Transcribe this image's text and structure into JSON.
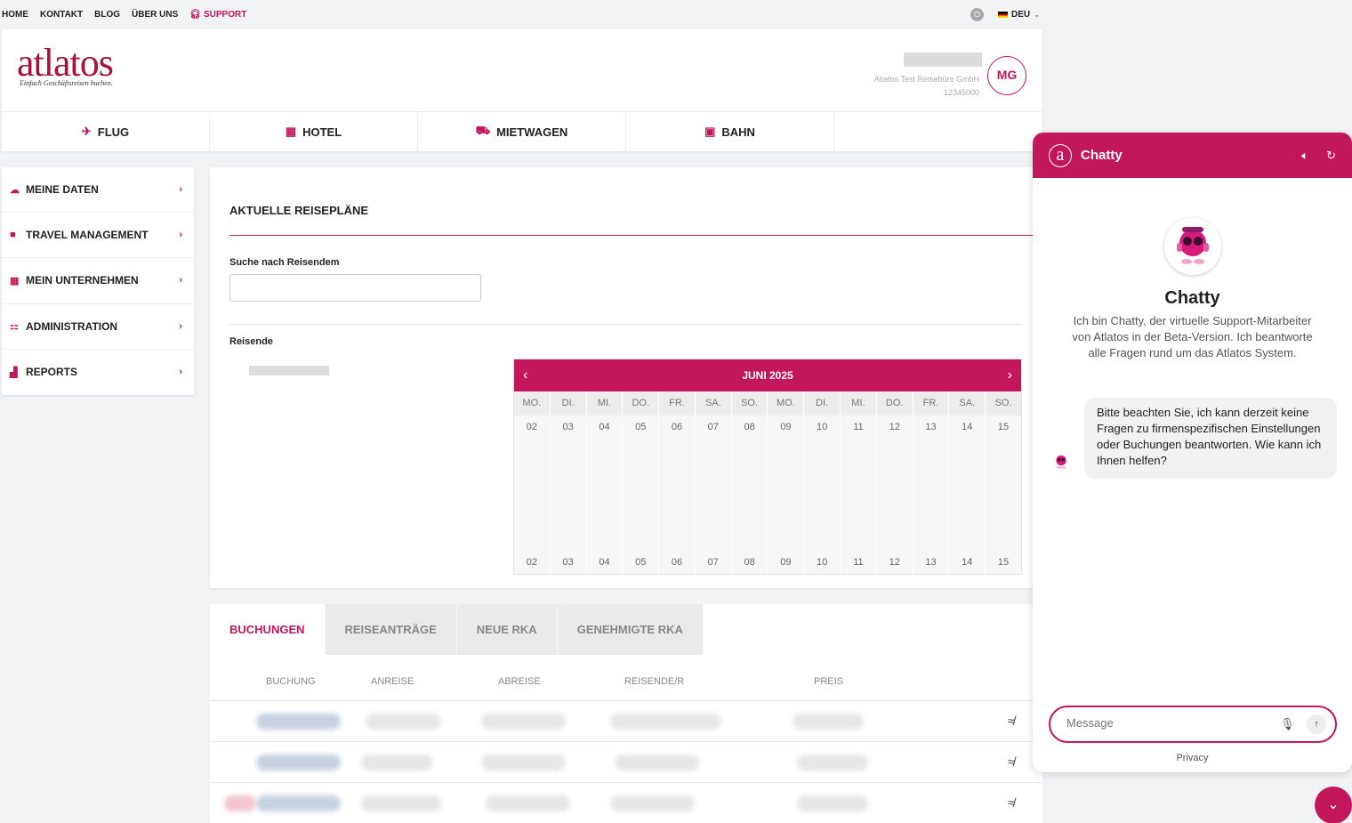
{
  "topnav": {
    "items": [
      "HOME",
      "KONTAKT",
      "BLOG",
      "ÜBER UNS"
    ],
    "support": "SUPPORT",
    "language": "DEU"
  },
  "header": {
    "logo": "atlatos",
    "tagline": "Einfach Geschäftsreisen buchen.",
    "company": "Atlatos Test Reisebüro GmbH",
    "company_id": "12345000",
    "avatar_initials": "MG"
  },
  "mainnav": [
    {
      "label": "FLUG",
      "icon": "plane-icon"
    },
    {
      "label": "HOTEL",
      "icon": "building-icon"
    },
    {
      "label": "MIETWAGEN",
      "icon": "car-icon"
    },
    {
      "label": "BAHN",
      "icon": "train-icon"
    }
  ],
  "sidebar": [
    {
      "label": "MEINE DATEN",
      "icon": "cloud-icon"
    },
    {
      "label": "TRAVEL MANAGEMENT",
      "icon": "briefcase-icon"
    },
    {
      "label": "MEIN UNTERNEHMEN",
      "icon": "company-icon"
    },
    {
      "label": "ADMINISTRATION",
      "icon": "org-chart-icon"
    },
    {
      "label": "REPORTS",
      "icon": "bar-chart-icon"
    }
  ],
  "plans": {
    "title": "AKTUELLE REISEPLÄNE",
    "search_label": "Suche nach Reisendem",
    "search_placeholder": "",
    "travellers_label": "Reisende"
  },
  "calendar": {
    "month": "JUNI 2025",
    "days": [
      {
        "name": "MO.",
        "num": "02"
      },
      {
        "name": "DI.",
        "num": "03"
      },
      {
        "name": "MI.",
        "num": "04"
      },
      {
        "name": "DO.",
        "num": "05"
      },
      {
        "name": "FR.",
        "num": "06"
      },
      {
        "name": "SA.",
        "num": "07"
      },
      {
        "name": "SO.",
        "num": "08"
      },
      {
        "name": "MO.",
        "num": "09"
      },
      {
        "name": "DI.",
        "num": "10"
      },
      {
        "name": "MI.",
        "num": "11"
      },
      {
        "name": "DO.",
        "num": "12"
      },
      {
        "name": "FR.",
        "num": "13"
      },
      {
        "name": "SA.",
        "num": "14"
      },
      {
        "name": "SO.",
        "num": "15"
      }
    ]
  },
  "bookings": {
    "tabs": [
      "BUCHUNGEN",
      "REISEANTRÄGE",
      "NEUE RKA",
      "GENEHMIGTE RKA"
    ],
    "columns": [
      "BUCHUNG",
      "ANREISE",
      "ABREISE",
      "REISENDE/R",
      "PREIS"
    ]
  },
  "chat": {
    "title": "Chatty",
    "bot_name": "Chatty",
    "intro": "Ich bin Chatty, der virtuelle Support-Mitarbeiter von Atlatos in der Beta-Version. Ich beantworte alle Fragen rund um das Atlatos System.",
    "message": "Bitte beachten Sie, ich kann derzeit keine Fragen zu firmenspezifischen Einstellungen oder Buchungen beantworten. Wie kann ich Ihnen helfen?",
    "input_placeholder": "Message",
    "privacy": "Privacy"
  },
  "colors": {
    "accent": "#c2185b",
    "logo": "#a8123e"
  }
}
